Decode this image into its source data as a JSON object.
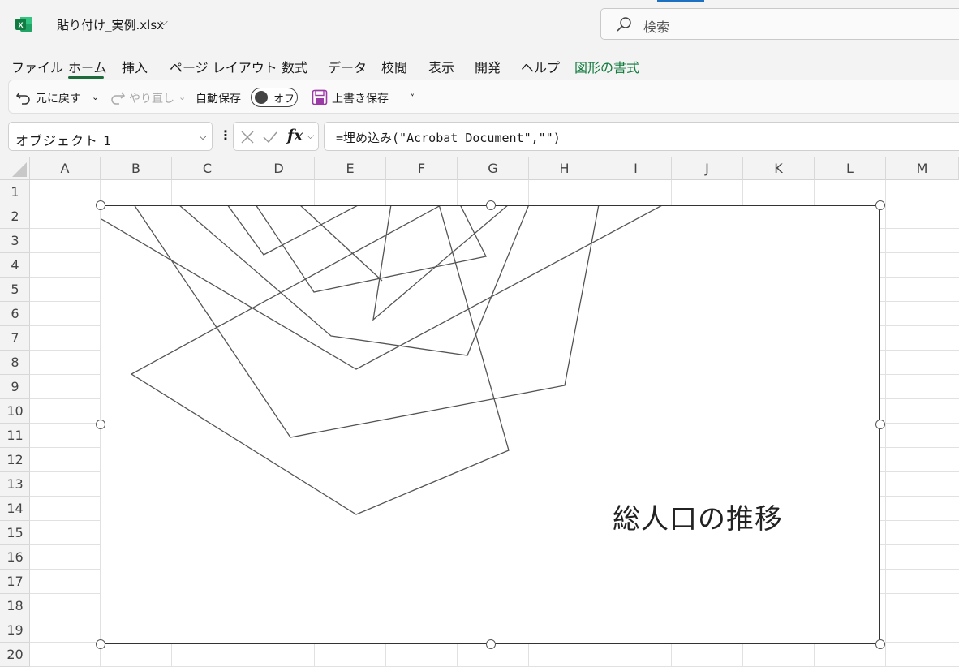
{
  "titlebar": {
    "doc_title": "貼り付け_実例.xlsx",
    "search_placeholder": "検索"
  },
  "tabs": [
    "ファイル",
    "ホーム",
    "挿入",
    "ページ レイアウト",
    "数式",
    "データ",
    "校閲",
    "表示",
    "開発",
    "ヘルプ",
    "図形の書式"
  ],
  "active_tab": "ホーム",
  "qat": {
    "undo": "元に戻す",
    "redo": "やり直し",
    "autosave": "自動保存",
    "autosave_state": "オフ",
    "save": "上書き保存"
  },
  "formula_bar": {
    "name_box": "オブジェクト 1",
    "formula": "=埋め込み(\"Acrobat Document\",\"\")"
  },
  "columns": [
    "A",
    "B",
    "C",
    "D",
    "E",
    "F",
    "G",
    "H",
    "I",
    "J",
    "K",
    "L",
    "M"
  ],
  "rows": [
    "1",
    "2",
    "3",
    "4",
    "5",
    "6",
    "7",
    "8",
    "9",
    "10",
    "11",
    "12",
    "13",
    "14",
    "15",
    "16",
    "17",
    "18",
    "19",
    "20"
  ],
  "embedded_object": {
    "caption": "総人口の推移"
  },
  "colors": {
    "excel_green": "#117a3d",
    "accent_blue": "#1d6fbf"
  }
}
